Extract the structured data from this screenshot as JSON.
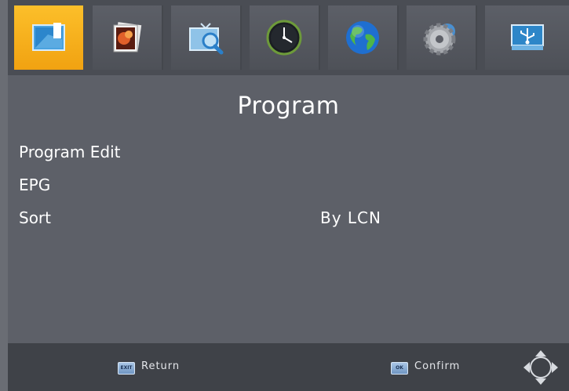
{
  "tabs": [
    {
      "icon": "program-icon",
      "active": true
    },
    {
      "icon": "picture-icon",
      "active": false
    },
    {
      "icon": "channel-search-icon",
      "active": false
    },
    {
      "icon": "time-icon",
      "active": false
    },
    {
      "icon": "globe-icon",
      "active": false
    },
    {
      "icon": "settings-gear-icon",
      "active": false
    },
    {
      "icon": "usb-icon",
      "active": false
    }
  ],
  "page": {
    "title": "Program"
  },
  "menu": [
    {
      "label": "Program Edit",
      "value": ""
    },
    {
      "label": "EPG",
      "value": ""
    },
    {
      "label": "Sort",
      "value": "By LCN"
    }
  ],
  "footer": {
    "exit_key": "EXIT",
    "return_label": "Return",
    "ok_key": "OK",
    "confirm_label": "Confirm"
  },
  "colors": {
    "accent": "#f5ab16",
    "background": "#5d6068",
    "footer": "#3f4248"
  }
}
